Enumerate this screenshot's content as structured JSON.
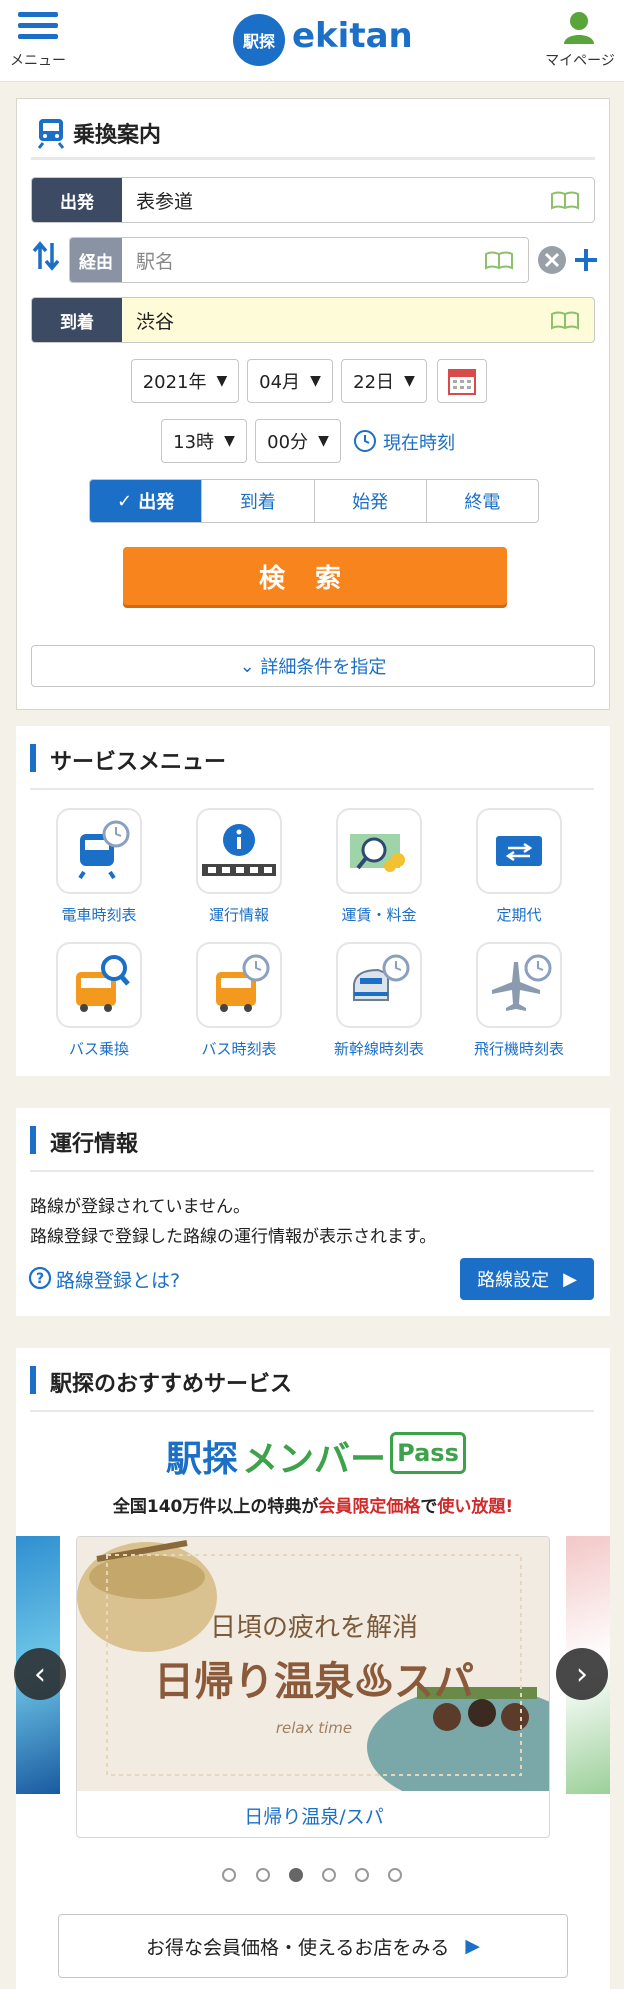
{
  "header": {
    "menu_label": "メニュー",
    "logo_badge": "駅探",
    "logo_text": "ekitan",
    "mypage_label": "マイページ"
  },
  "transfer": {
    "title": "乗換案内",
    "departure_label": "出発",
    "departure_value": "表参道",
    "via_label": "経由",
    "via_placeholder": "駅名",
    "arrival_label": "到着",
    "arrival_value": "渋谷",
    "year": "2021年",
    "month": "04月",
    "day": "22日",
    "hour": "13時",
    "minute": "00分",
    "current_time": "現在時刻",
    "modes": [
      "出発",
      "到着",
      "始発",
      "終電"
    ],
    "search": "検索",
    "detail": "詳細条件を指定"
  },
  "service_menu": {
    "title": "サービスメニュー",
    "items": [
      "電車時刻表",
      "運行情報",
      "運賃・料金",
      "定期代",
      "バス乗換",
      "バス時刻表",
      "新幹線時刻表",
      "飛行機時刻表"
    ]
  },
  "operation": {
    "title": "運行情報",
    "line1": "路線が登録されていません。",
    "line2": "路線登録で登録した路線の運行情報が表示されます。",
    "help_link": "路線登録とは?",
    "settings_button": "路線設定"
  },
  "recommend": {
    "title": "駅探のおすすめサービス",
    "brand_main": "駅探",
    "brand_member": "メンバー",
    "brand_pass": "Pass",
    "tagline_prefix": "全国140万件以上の特典が",
    "tagline_red1": "会員限定価格",
    "tagline_mid": "で",
    "tagline_red2": "使い放題!",
    "banner_line1": "日頃の疲れを解消",
    "banner_line2": "日帰り温泉♨スパ",
    "banner_sub": "relax time",
    "card_caption": "日帰り温泉/スパ",
    "dots_active_index": 2,
    "cta": "お得な会員価格・使えるお店をみる"
  },
  "colors": {
    "accent": "#1b6fc7",
    "orange": "#f7841c",
    "navy": "#3c4a63"
  }
}
